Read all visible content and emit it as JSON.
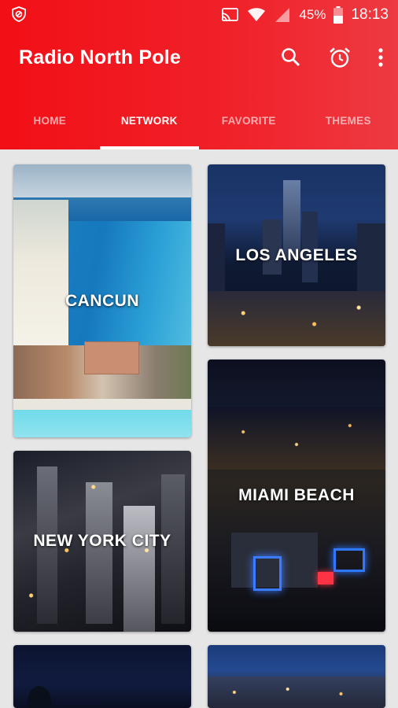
{
  "status_bar": {
    "battery_percent": "45%",
    "time": "18:13"
  },
  "app": {
    "title": "Radio North Pole"
  },
  "tabs": [
    {
      "label": "HOME",
      "active": false
    },
    {
      "label": "NETWORK",
      "active": true
    },
    {
      "label": "FAVORITE",
      "active": false
    },
    {
      "label": "THEMES",
      "active": false
    }
  ],
  "cards": [
    {
      "name": "CANCUN"
    },
    {
      "name": "LOS ANGELES"
    },
    {
      "name": "NEW YORK CITY"
    },
    {
      "name": "MIAMI BEACH"
    },
    {
      "name": ""
    },
    {
      "name": ""
    }
  ],
  "colors": {
    "accent": "#f20f16",
    "background": "#e6e6e6"
  },
  "icons": {
    "status": [
      "shield-icon",
      "cast-icon",
      "wifi-icon",
      "signal-icon",
      "battery-icon"
    ],
    "actions": [
      "search-icon",
      "alarm-icon",
      "more-vert-icon"
    ]
  }
}
